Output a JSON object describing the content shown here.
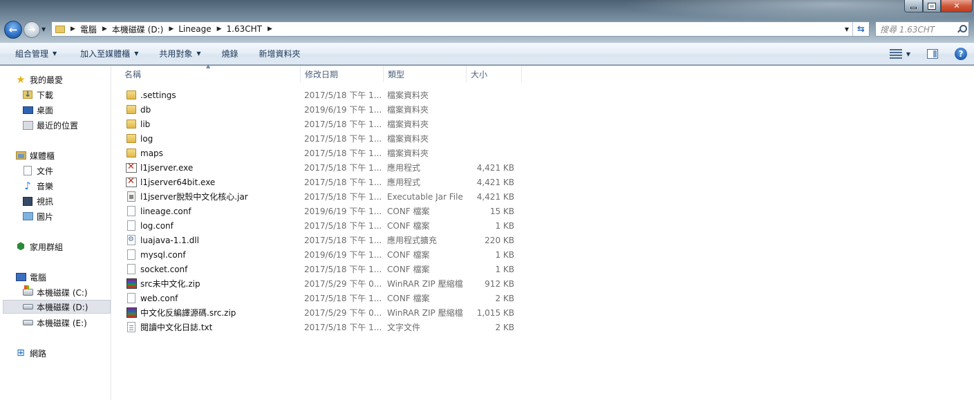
{
  "window": {
    "controls": {
      "min": "",
      "max": "",
      "close": "✕"
    }
  },
  "address": {
    "crumbs": [
      "電腦",
      "本機磁碟 (D:)",
      "Lineage",
      "1.63CHT"
    ]
  },
  "search": {
    "placeholder": "搜尋 1.63CHT"
  },
  "toolbar": {
    "organize": "組合管理",
    "include_library": "加入至媒體櫃",
    "share": "共用對象",
    "burn": "燒錄",
    "new_folder": "新增資料夾"
  },
  "nav": {
    "favorites": "我的最愛",
    "downloads": "下載",
    "desktop": "桌面",
    "recent": "最近的位置",
    "libraries": "媒體櫃",
    "documents": "文件",
    "music": "音樂",
    "videos": "視訊",
    "pictures": "圖片",
    "homegroup": "家用群組",
    "computer": "電腦",
    "drive_c": "本機磁碟 (C:)",
    "drive_d": "本機磁碟 (D:)",
    "drive_e": "本機磁碟 (E:)",
    "network": "網路"
  },
  "columns": {
    "name": "名稱",
    "date": "修改日期",
    "type": "類型",
    "size": "大小"
  },
  "files": [
    {
      "name": ".settings",
      "date": "2017/5/18 下午 1...",
      "type": "檔案資料夾",
      "size": "",
      "icon": "folder"
    },
    {
      "name": "db",
      "date": "2019/6/19 下午 1...",
      "type": "檔案資料夾",
      "size": "",
      "icon": "folder"
    },
    {
      "name": "lib",
      "date": "2017/5/18 下午 1...",
      "type": "檔案資料夾",
      "size": "",
      "icon": "folder"
    },
    {
      "name": "log",
      "date": "2017/5/18 下午 1...",
      "type": "檔案資料夾",
      "size": "",
      "icon": "folder"
    },
    {
      "name": "maps",
      "date": "2017/5/18 下午 1...",
      "type": "檔案資料夾",
      "size": "",
      "icon": "folder"
    },
    {
      "name": "l1jserver.exe",
      "date": "2017/5/18 下午 1...",
      "type": "應用程式",
      "size": "4,421 KB",
      "icon": "exe"
    },
    {
      "name": "l1jserver64bit.exe",
      "date": "2017/5/18 下午 1...",
      "type": "應用程式",
      "size": "4,421 KB",
      "icon": "exe"
    },
    {
      "name": "l1jserver脫殼中文化核心.jar",
      "date": "2017/5/18 下午 1...",
      "type": "Executable Jar File",
      "size": "4,421 KB",
      "icon": "jar"
    },
    {
      "name": "lineage.conf",
      "date": "2019/6/19 下午 1...",
      "type": "CONF 檔案",
      "size": "15 KB",
      "icon": "doc"
    },
    {
      "name": "log.conf",
      "date": "2017/5/18 下午 1...",
      "type": "CONF 檔案",
      "size": "1 KB",
      "icon": "doc"
    },
    {
      "name": "luajava-1.1.dll",
      "date": "2017/5/18 下午 1...",
      "type": "應用程式擴充",
      "size": "220 KB",
      "icon": "dll"
    },
    {
      "name": "mysql.conf",
      "date": "2019/6/19 下午 1...",
      "type": "CONF 檔案",
      "size": "1 KB",
      "icon": "doc"
    },
    {
      "name": "socket.conf",
      "date": "2017/5/18 下午 1...",
      "type": "CONF 檔案",
      "size": "1 KB",
      "icon": "doc"
    },
    {
      "name": "src未中文化.zip",
      "date": "2017/5/29 下午 0...",
      "type": "WinRAR ZIP 壓縮檔",
      "size": "912 KB",
      "icon": "zip"
    },
    {
      "name": "web.conf",
      "date": "2017/5/18 下午 1...",
      "type": "CONF 檔案",
      "size": "2 KB",
      "icon": "doc"
    },
    {
      "name": "中文化反編譯源碼.src.zip",
      "date": "2017/5/29 下午 0...",
      "type": "WinRAR ZIP 壓縮檔",
      "size": "1,015 KB",
      "icon": "zip"
    },
    {
      "name": "閱讀中文化日誌.txt",
      "date": "2017/5/18 下午 1...",
      "type": "文字文件",
      "size": "2 KB",
      "icon": "txt"
    }
  ]
}
